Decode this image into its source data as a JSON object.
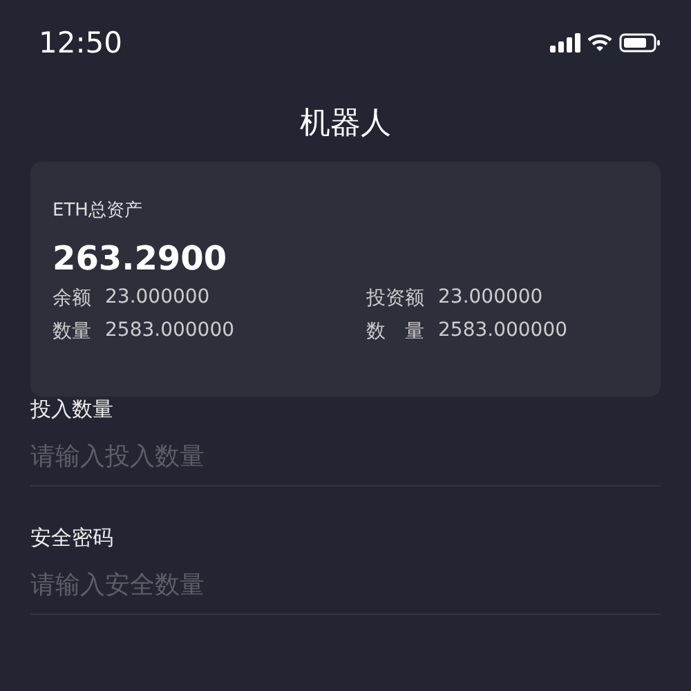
{
  "status_bar": {
    "time": "12:50"
  },
  "title": "机器人",
  "card": {
    "label": "ETH总资产",
    "total": "263.2900",
    "stats": [
      {
        "label": "余额",
        "value": "23.000000"
      },
      {
        "label": "投资额",
        "value": "23.000000"
      },
      {
        "label": "数量",
        "value": "2583.000000"
      },
      {
        "label": "数　量",
        "value": "2583.000000"
      }
    ]
  },
  "fields": [
    {
      "label": "投入数量",
      "placeholder": "请输入投入数量"
    },
    {
      "label": "安全密码",
      "placeholder": "请输入安全数量"
    }
  ]
}
